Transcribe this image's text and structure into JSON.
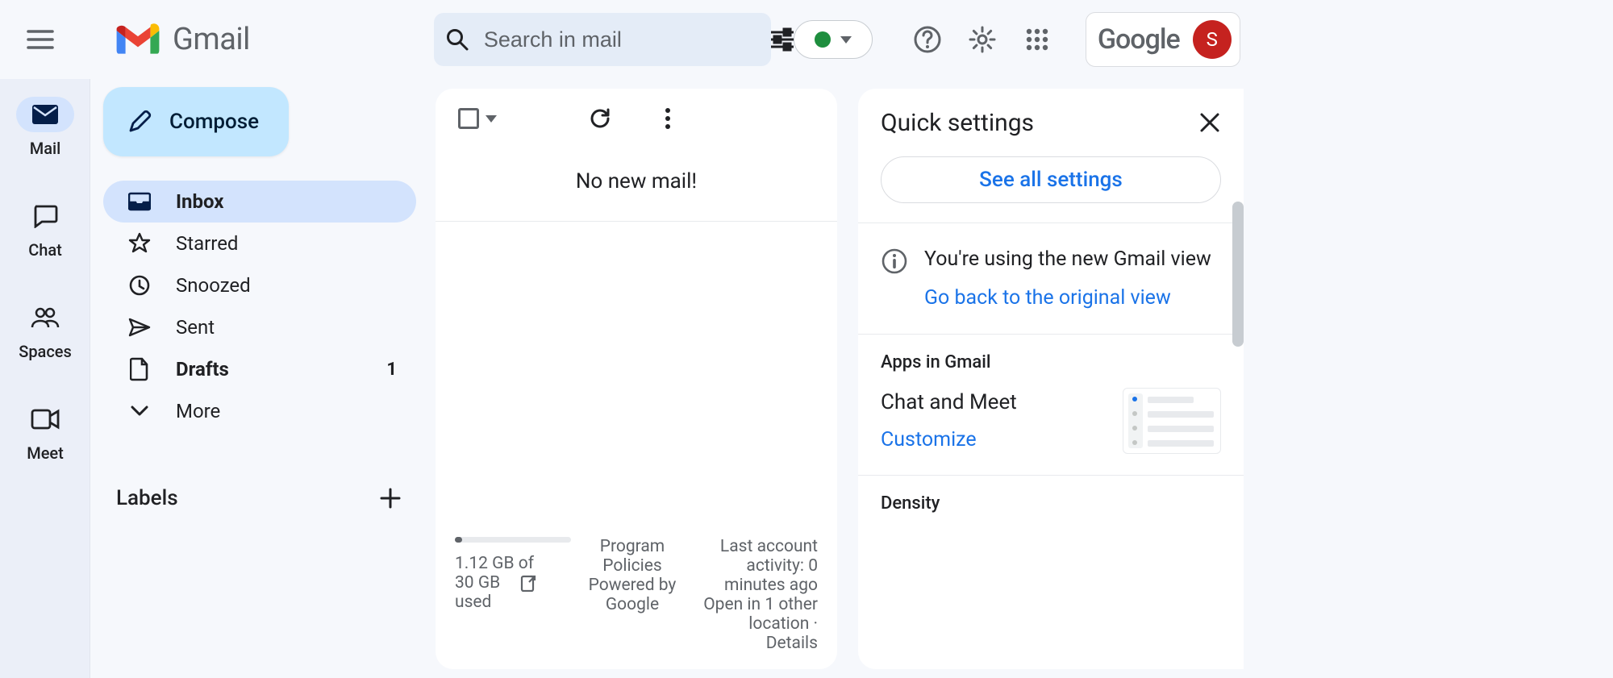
{
  "brand": {
    "name": "Gmail"
  },
  "search": {
    "placeholder": "Search in mail"
  },
  "header": {
    "google_label": "Google",
    "avatar_initial": "S",
    "status_color": "#1e8e3e"
  },
  "rail": {
    "items": [
      {
        "label": "Mail",
        "active": true
      },
      {
        "label": "Chat",
        "active": false
      },
      {
        "label": "Spaces",
        "active": false
      },
      {
        "label": "Meet",
        "active": false
      }
    ]
  },
  "sidebar": {
    "compose_label": "Compose",
    "items": [
      {
        "label": "Inbox",
        "selected": true,
        "bold": true,
        "count": ""
      },
      {
        "label": "Starred",
        "selected": false,
        "bold": false,
        "count": ""
      },
      {
        "label": "Snoozed",
        "selected": false,
        "bold": false,
        "count": ""
      },
      {
        "label": "Sent",
        "selected": false,
        "bold": false,
        "count": ""
      },
      {
        "label": "Drafts",
        "selected": false,
        "bold": true,
        "count": "1"
      },
      {
        "label": "More",
        "selected": false,
        "bold": false,
        "count": ""
      }
    ],
    "labels_heading": "Labels"
  },
  "main": {
    "empty_message": "No new mail!",
    "storage_used_line1": "1.12 GB of",
    "storage_used_line2": "30 GB",
    "storage_used_line3": "used",
    "policies_line1": "Program",
    "policies_line2": "Policies",
    "powered_line1": "Powered by",
    "powered_line2": "Google",
    "activity_line1": "Last account",
    "activity_line2": "activity: 0",
    "activity_line3": "minutes ago",
    "activity_line4": "Open in 1 other",
    "activity_line5": "location ·",
    "activity_details": "Details"
  },
  "qsettings": {
    "title": "Quick settings",
    "see_all": "See all settings",
    "notice_text": "You're using the new Gmail view",
    "notice_link": "Go back to the original view",
    "apps_heading": "Apps in Gmail",
    "chat_meet_label": "Chat and Meet",
    "customize_label": "Customize",
    "density_heading": "Density"
  },
  "colors": {
    "accent": "#1a73e8",
    "compose_bg": "#c2e7ff",
    "selected_bg": "#d3e3fd"
  }
}
